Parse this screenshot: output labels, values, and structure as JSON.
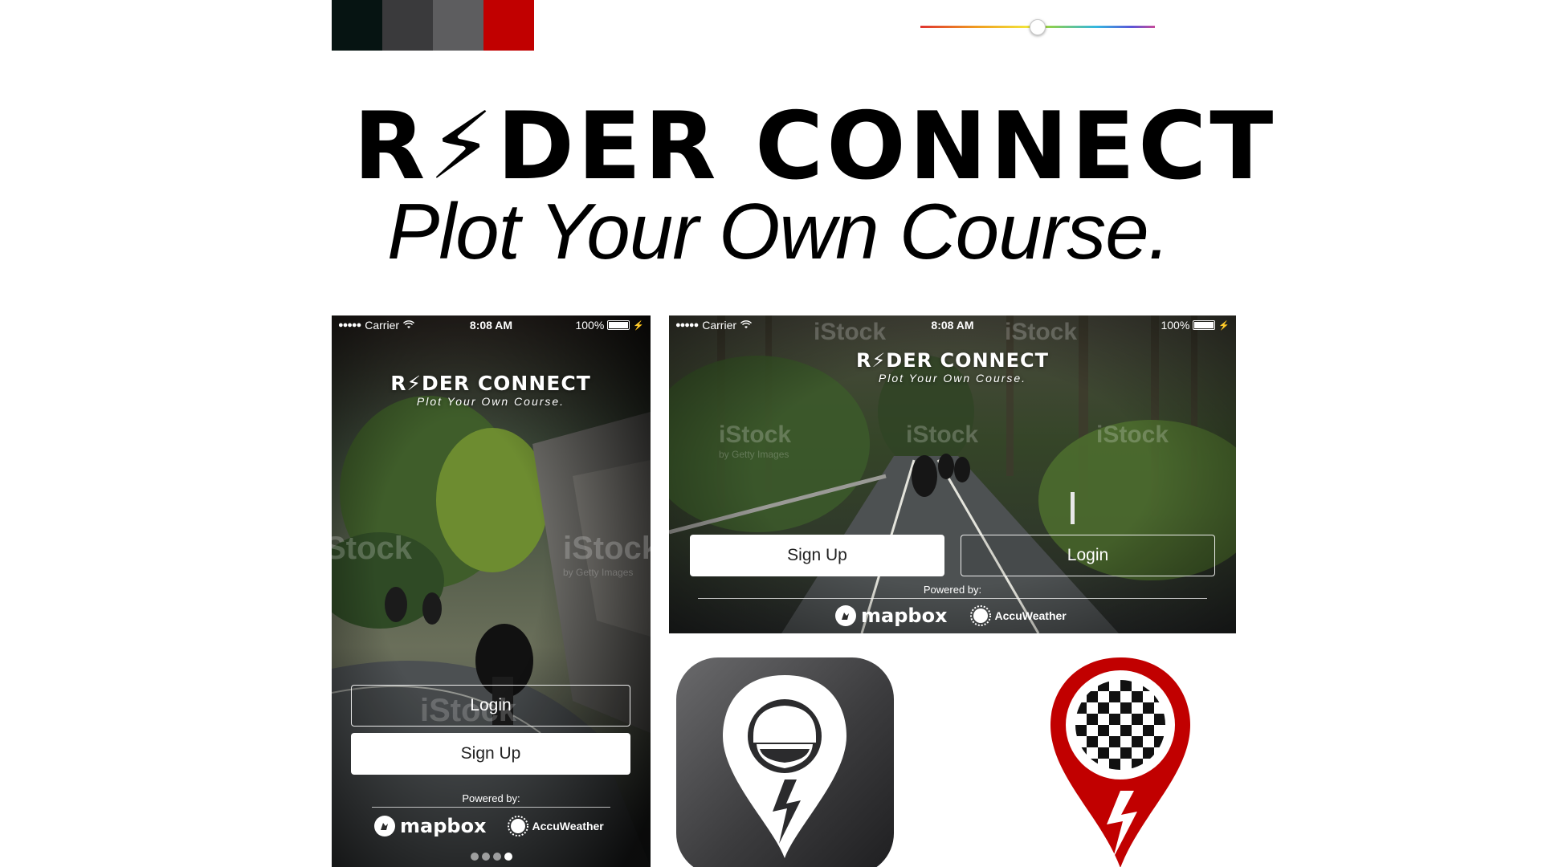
{
  "palette": {
    "colors": [
      "#061412",
      "#3a3a3c",
      "#5d5d5f",
      "#c10000"
    ]
  },
  "slider": {
    "value": 0.5
  },
  "brand": {
    "title": "R⚡DER CONNECT",
    "tagline": "Plot Your Own Course."
  },
  "phone_portrait": {
    "status": {
      "signal": "●●●●●",
      "carrier": "Carrier",
      "time": "8:08 AM",
      "battery": "100%"
    },
    "logo": {
      "title": "R⚡DER CONNECT",
      "tagline": "Plot Your Own Course."
    },
    "login_label": "Login",
    "signup_label": "Sign Up",
    "powered_by": "Powered by:",
    "partners": {
      "mapbox": "mapbox",
      "accuweather": "AccuWeather"
    },
    "page_count": 4,
    "current_page": 4
  },
  "phone_landscape": {
    "status": {
      "signal": "●●●●●",
      "carrier": "Carrier",
      "time": "8:08 AM",
      "battery": "100%"
    },
    "logo": {
      "title": "R⚡DER CONNECT",
      "tagline": "Plot Your Own Course."
    },
    "signup_label": "Sign Up",
    "login_label": "Login",
    "powered_by": "Powered by:",
    "partners": {
      "mapbox": "mapbox",
      "accuweather": "AccuWeather"
    }
  },
  "watermark": {
    "brand": "iStock",
    "sub": "by Getty Images"
  },
  "icons": {
    "dark_app_icon": "helmet-pin-icon",
    "red_app_icon": "checkered-flag-pin-icon"
  }
}
